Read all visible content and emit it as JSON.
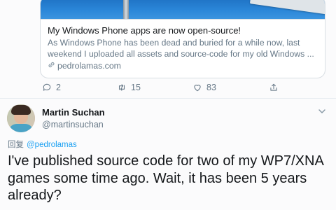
{
  "link_card": {
    "title": "My Windows Phone apps are now open-source!",
    "description_lines": [
      "As Windows Phone has been dead and buried for a while now, last",
      "weekend I uploaded all assets and source-code for my old Windows ..."
    ],
    "domain": "pedrolamas.com"
  },
  "actions": {
    "reply_count": "2",
    "retweet_count": "15",
    "like_count": "83"
  },
  "reply_tweet": {
    "author_name": "Martin Suchan",
    "author_handle": "@martinsuchan",
    "reply_prefix": "回复",
    "reply_mention": "@pedrolamas",
    "text_lines": [
      "I've published source code for two of my WP7/XNA",
      "games some time ago. Wait, it has been 5 years",
      "already?"
    ]
  },
  "colors": {
    "accent": "#1da1f2",
    "secondary_text": "#657786",
    "border": "#e6ecf0"
  }
}
